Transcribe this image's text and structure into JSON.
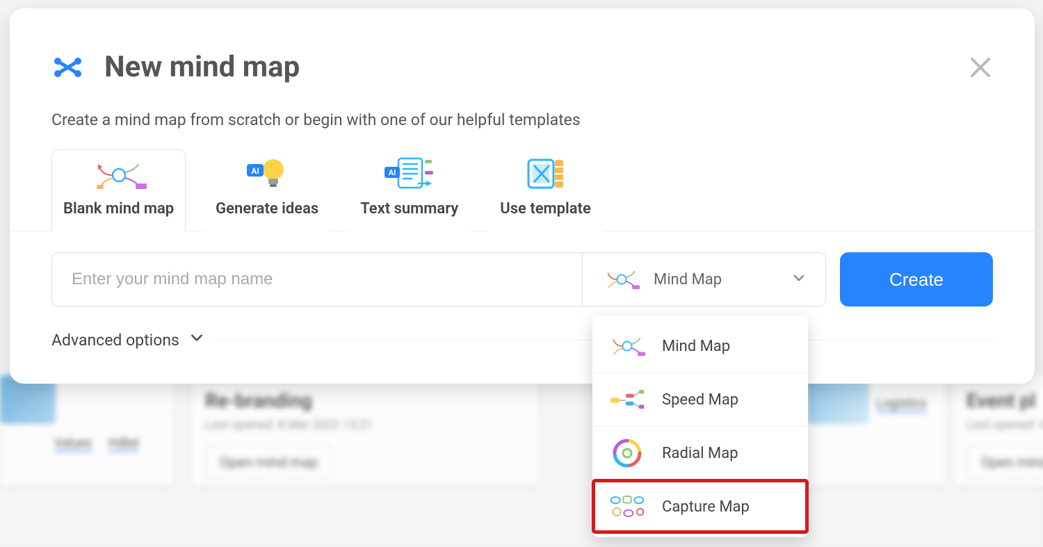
{
  "modal": {
    "title": "New mind map",
    "subtitle": "Create a mind map from scratch or begin with one of our helpful templates"
  },
  "tabs": [
    {
      "label": "Blank mind map"
    },
    {
      "label": "Generate ideas"
    },
    {
      "label": "Text summary"
    },
    {
      "label": "Use template"
    }
  ],
  "form": {
    "name_placeholder": "Enter your mind map name",
    "type_selected": "Mind Map",
    "create_label": "Create"
  },
  "advanced": {
    "label": "Advanced options"
  },
  "map_types": [
    {
      "label": "Mind Map"
    },
    {
      "label": "Speed Map"
    },
    {
      "label": "Radial Map"
    },
    {
      "label": "Capture Map"
    }
  ],
  "background": {
    "card2": {
      "title": "Re-branding",
      "sub": "Last opened: 8 Mar 2022 13:21",
      "btn": "Open mind map"
    },
    "card1": {
      "tag1": "Values",
      "tag2": "Hdbd"
    },
    "card3": {
      "tag": "Logistics"
    },
    "card4": {
      "title": "Event pl",
      "sub": "Last opened: 4 M",
      "btn": "Open mind"
    }
  }
}
